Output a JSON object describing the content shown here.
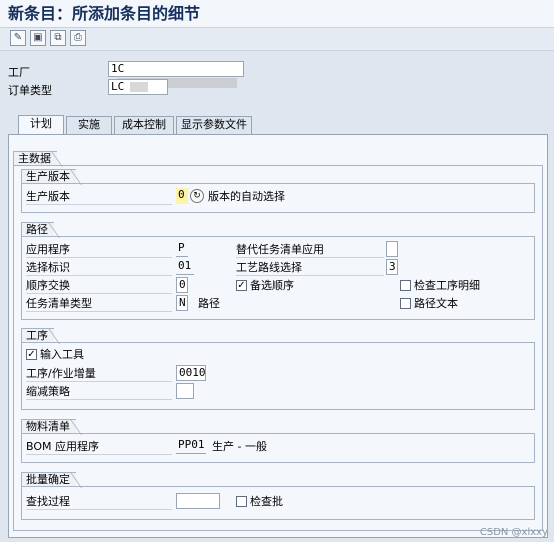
{
  "window": {
    "title": "新条目：所添加条目的细节"
  },
  "toolbar": {
    "buttons": [
      "edit-icon",
      "save-variant-icon",
      "copy-icon",
      "print-icon"
    ]
  },
  "header": {
    "plant_label": "工厂",
    "plant_value": "1C",
    "order_type_label": "订单类型",
    "order_type_value": "LC"
  },
  "tabs": [
    {
      "label": "计划"
    },
    {
      "label": "实施"
    },
    {
      "label": "成本控制"
    },
    {
      "label": "显示参数文件"
    }
  ],
  "main": {
    "title": "主数据"
  },
  "production_version": {
    "title": "生产版本",
    "field_label": "生产版本",
    "field_value": "0",
    "desc": "版本的自动选择"
  },
  "routing": {
    "title": "路径",
    "application_label": "应用程序",
    "application_value": "P",
    "selection_id_label": "选择标识",
    "selection_id_value": "01",
    "sequence_exchange_label": "顺序交换",
    "sequence_exchange_value": "0",
    "task_list_type_label": "任务清单类型",
    "task_list_type_value": "N",
    "task_list_type_desc": "路径",
    "alt_task_list_label": "替代任务清单应用",
    "alt_task_list_value": "",
    "routing_selection_label": "工艺路线选择",
    "routing_selection_value": "3",
    "alt_sequence_label": "备选顺序",
    "alt_sequence_checked": true,
    "check_operation_detail_label": "检查工序明细",
    "check_operation_detail_checked": false,
    "routing_text_label": "路径文本",
    "routing_text_checked": false
  },
  "operation": {
    "title": "工序",
    "input_tools_label": "输入工具",
    "input_tools_checked": true,
    "increment_label": "工序/作业增量",
    "increment_value": "0010",
    "scrap_strategy_label": "缩减策略",
    "scrap_strategy_value": ""
  },
  "bom": {
    "title": "物料清单",
    "application_label": "BOM 应用程序",
    "application_value": "PP01",
    "application_desc": "生产 - 一般"
  },
  "batch": {
    "title": "批量确定",
    "search_label": "查找过程",
    "search_value": "",
    "check_batch_label": "检查批",
    "check_batch_checked": false
  },
  "watermark": "CSDN @xlxxy"
}
